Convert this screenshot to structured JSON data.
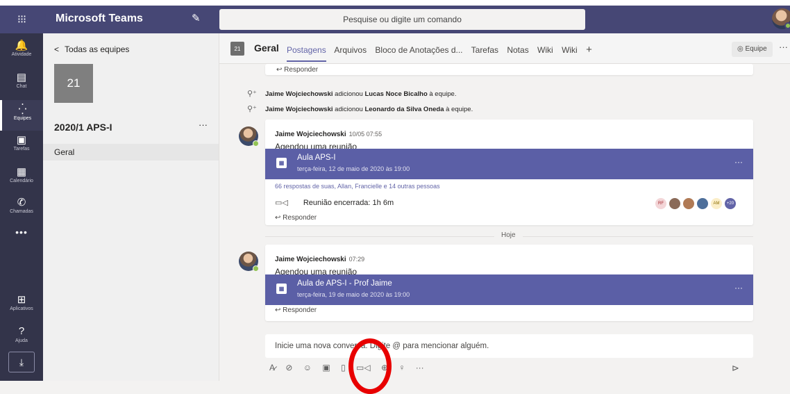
{
  "topbar": {
    "apps_icon": "⁝⁝⁝",
    "title": "Microsoft Teams",
    "compose_icon": "✎",
    "search_placeholder": "Pesquise ou digite um comando"
  },
  "rail": {
    "items": [
      {
        "icon": "🔔",
        "label": "Atividade"
      },
      {
        "icon": "▤",
        "label": "Chat"
      },
      {
        "icon": "⁛",
        "label": "Equipes"
      },
      {
        "icon": "▣",
        "label": "Tarefas"
      },
      {
        "icon": "▦",
        "label": "Calendário"
      },
      {
        "icon": "✆",
        "label": "Chamadas"
      },
      {
        "icon": "⊞",
        "label": "Aplicativos"
      },
      {
        "icon": "?",
        "label": "Ajuda"
      }
    ],
    "more": "•••",
    "download_icon": "⤓"
  },
  "leftpane": {
    "back": "Todas as equipes",
    "team_tile": "21",
    "team_name": "2020/1 APS-I",
    "team_more": "···",
    "channel": "Geral"
  },
  "header": {
    "tile": "21",
    "channel": "Geral",
    "tabs": [
      "Postagens",
      "Arquivos",
      "Bloco de Anotações d...",
      "Tarefas",
      "Notas",
      "Wiki",
      "Wiki"
    ],
    "add_tab": "+",
    "team_button": "◎ Equipe",
    "more": "···"
  },
  "feed": {
    "reply_label": "Responder",
    "sys1": {
      "actor": "Jaime Wojciechowski",
      "verb": " adicionou ",
      "target": "Lucas Noce Bicalho",
      "rest": " à equipe."
    },
    "sys2": {
      "actor": "Jaime Wojciechowski",
      "verb": " adicionou ",
      "target": "Leonardo da Silva Oneda",
      "rest": " à equipe."
    },
    "post1": {
      "author": "Jaime Wojciechowski",
      "time": "10/05 07:55",
      "message": "Agendou uma reunião",
      "meeting_title": "Aula APS-I",
      "meeting_date": "terça-feira, 12 de maio de 2020 às 19:00",
      "replies": "66 respostas de suas, Allan, Francielle e 14 outras pessoas",
      "ended": "Reunião encerrada: 1h 6m",
      "participants": [
        "RF",
        "",
        "",
        "",
        "AM",
        "+20"
      ]
    },
    "today": "Hoje",
    "post2": {
      "author": "Jaime Wojciechowski",
      "time": "07:29",
      "message": "Agendou uma reunião",
      "meeting_title": "Aula de APS-I - Prof Jaime",
      "meeting_date": "terça-feira, 19 de maio de 2020 às 19:00"
    },
    "compose_placeholder": "Inicie uma nova conversa. Digite @ para mencionar alguém.",
    "toolbar": [
      "A̷",
      "⊘",
      "☺",
      "▣",
      "▯",
      "▭◁",
      "⊕",
      "♀",
      "···"
    ],
    "send": "⊳"
  }
}
